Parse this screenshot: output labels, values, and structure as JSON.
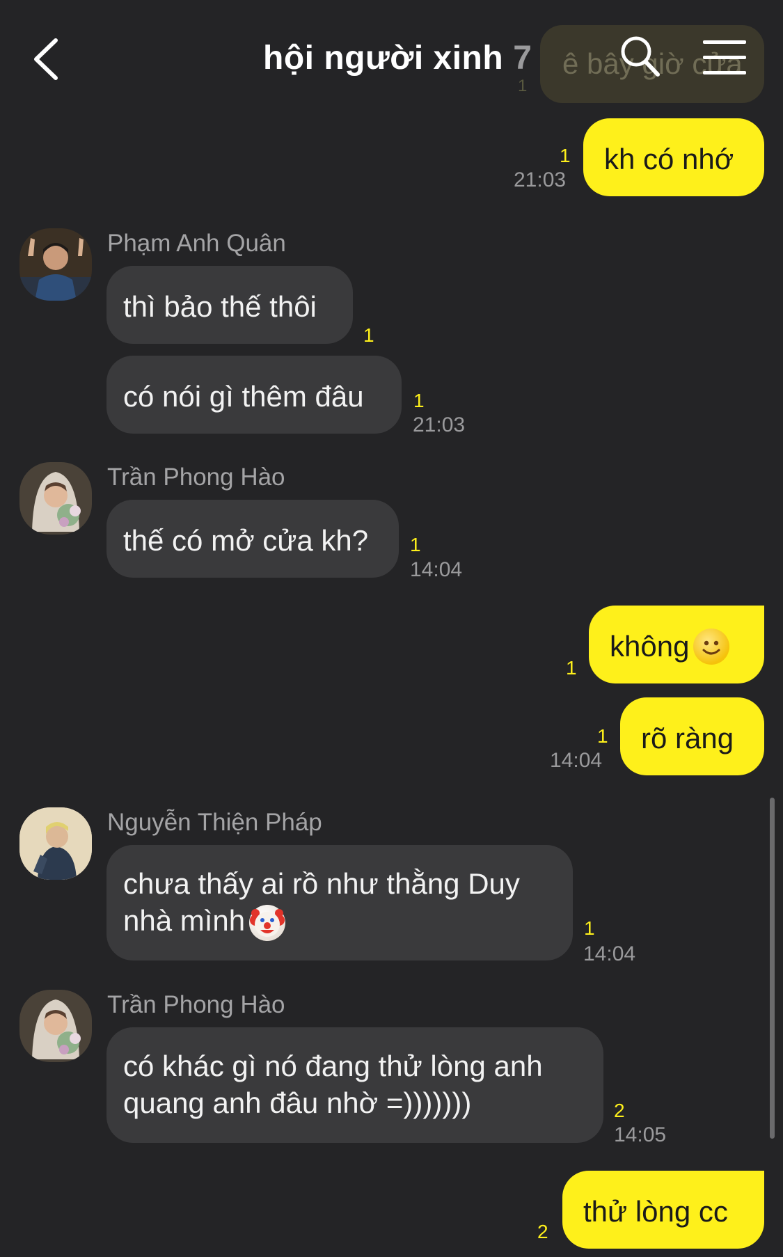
{
  "header": {
    "title": "hội người xinh",
    "member_count": "7",
    "ghost_message": "ê bây giờ cửa",
    "ghost_unread": "1"
  },
  "messages": [
    {
      "text": "kh có nhớ",
      "unread": "1",
      "time": "21:03"
    },
    {
      "sender": "Phạm Anh Quân",
      "text": "thì bảo thế thôi",
      "unread": "1"
    },
    {
      "text": "có nói gì thêm đâu",
      "unread": "1",
      "time": "21:03"
    },
    {
      "sender": "Trần Phong Hào",
      "text": "thế có mở cửa kh?",
      "unread": "1",
      "time": "14:04"
    },
    {
      "text": "không",
      "unread": "1",
      "emoji": "slightly-smiling-face"
    },
    {
      "text": "rõ ràng",
      "unread": "1",
      "time": "14:04"
    },
    {
      "sender": "Nguyễn Thiện Pháp",
      "text_line1": "chưa thấy ai rồ như thằng Duy",
      "text_line2": "nhà mình",
      "unread": "1",
      "time": "14:04",
      "emoji": "clown-face"
    },
    {
      "sender": "Trần Phong Hào",
      "text_line1": "có khác gì nó đang thử lòng anh",
      "text_line2": "quang anh đâu nhờ =)))))))",
      "unread": "2",
      "time": "14:05"
    },
    {
      "text": "thử lòng cc",
      "unread": "2"
    }
  ],
  "colors": {
    "background": "#242426",
    "incoming_bubble": "#3a3a3c",
    "outgoing_bubble": "#fef01b",
    "unread_count": "#fef01b",
    "timestamp": "#9a9a9c"
  },
  "icons": [
    "back-arrow-icon",
    "search-icon",
    "menu-icon",
    "avatar",
    "smiley-emoji-icon",
    "clown-emoji-icon"
  ]
}
